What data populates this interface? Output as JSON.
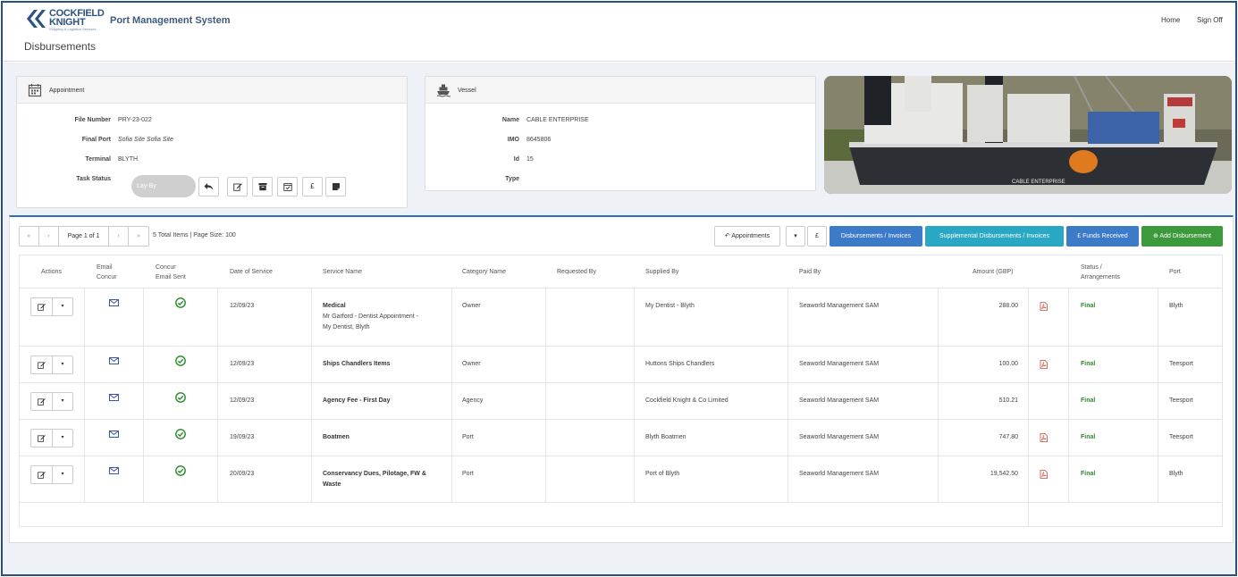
{
  "header": {
    "logo_line1": "COCKFIELD",
    "logo_line2": "KNIGHT",
    "logo_tagline": "Shipping & Logistics Services",
    "app_title": "Port Management System",
    "page_title": "Disbursements",
    "nav": {
      "home": "Home",
      "sign_off": "Sign Off"
    }
  },
  "appointment": {
    "title": "Appointment",
    "fields": {
      "file_number_label": "File Number",
      "file_number": "PRY-23-022",
      "final_port_label": "Final Port",
      "final_port": "Sofia Site Sofia Site",
      "terminal_label": "Terminal",
      "terminal": "BLYTH",
      "task_status_label": "Task Status",
      "task_status": "Lay-By"
    },
    "pound_symbol": "£"
  },
  "vessel": {
    "title": "Vessel",
    "fields": {
      "name_label": "Name",
      "name": "CABLE ENTERPRISE",
      "imo_label": "IMO",
      "imo": "8645806",
      "id_label": "Id",
      "id": "15",
      "type_label": "Type",
      "type": ""
    },
    "photo_caption": "CABLE ENTERPRISE"
  },
  "toolbar": {
    "pager_first": "«",
    "pager_prev": "‹",
    "pager_page": "Page 1 of 1",
    "pager_next": "›",
    "pager_last": "»",
    "pager_info": "5 Total Items | Page Size: 100",
    "appointments": "Appointments",
    "pound": "£",
    "disbursements_invoices": "Disbursements / Invoices",
    "supplemental": "Supplemental Disbursements / Invoices",
    "funds_received": "£ Funds Received",
    "add_disbursement": "Add Disbursement",
    "colors": {
      "blue": "#3d7bc8",
      "teal": "#2aa7c3",
      "green": "#3c9a3c"
    }
  },
  "table": {
    "headers": {
      "actions": "Actions",
      "email_concur_1": "Email",
      "email_concur_2": "Concur",
      "concur_sent_1": "Concur",
      "concur_sent_2": "Email Sent",
      "date": "Date of Service",
      "service": "Service Name",
      "category": "Category Name",
      "requested": "Requested By",
      "supplied": "Supplied By",
      "paid": "Paid By",
      "amount": "Amount (GBP)",
      "status_1": "Status  /",
      "status_2": "Arrangements",
      "port": "Port"
    },
    "rows": [
      {
        "date": "12/09/23",
        "service": "Medical",
        "service_sub_1": "Mr Garford - Dentist Appointment -",
        "service_sub_2": "My Dentist, Blyth",
        "category": "Owner",
        "requested": "",
        "supplied": "My Dentist - Blyth",
        "paid": "Seaworld Management SAM",
        "amount": "288.00",
        "pdf": true,
        "status": "Final",
        "port": "Blyth"
      },
      {
        "date": "12/09/23",
        "service": "Ships Chandlers Items",
        "service_sub_1": "",
        "service_sub_2": "",
        "category": "Owner",
        "requested": "",
        "supplied": "Huttons Ships Chandlers",
        "paid": "Seaworld Management SAM",
        "amount": "100.00",
        "pdf": true,
        "status": "Final",
        "port": "Teesport"
      },
      {
        "date": "12/09/23",
        "service": "Agency Fee - First Day",
        "service_sub_1": "",
        "service_sub_2": "",
        "category": "Agency",
        "requested": "",
        "supplied": "Cockfield Knight & Co Limited",
        "paid": "Seaworld Management SAM",
        "amount": "510.21",
        "pdf": false,
        "status": "Final",
        "port": "Teesport"
      },
      {
        "date": "19/09/23",
        "service": "Boatmen",
        "service_sub_1": "",
        "service_sub_2": "",
        "category": "Port",
        "requested": "",
        "supplied": "Blyth Boatmen",
        "paid": "Seaworld Management SAM",
        "amount": "747.80",
        "pdf": true,
        "status": "Final",
        "port": "Teesport"
      },
      {
        "date": "20/09/23",
        "service": "Conservancy Dues, Pilotage, FW &",
        "service_sub_1": "Waste",
        "service_sub_2": "",
        "category": "Port",
        "requested": "",
        "supplied": "Port of Blyth",
        "paid": "Seaworld Management SAM",
        "amount": "19,542.50",
        "pdf": true,
        "status": "Final",
        "port": "Blyth"
      }
    ]
  }
}
